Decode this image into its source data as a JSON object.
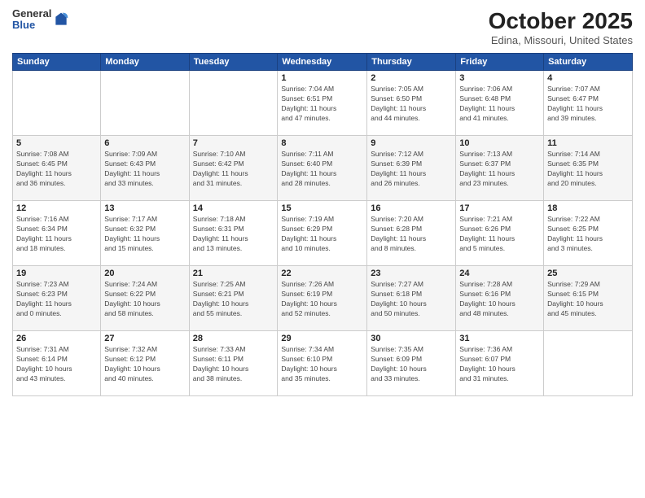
{
  "header": {
    "logo": {
      "general": "General",
      "blue": "Blue"
    },
    "title": "October 2025",
    "location": "Edina, Missouri, United States"
  },
  "days_of_week": [
    "Sunday",
    "Monday",
    "Tuesday",
    "Wednesday",
    "Thursday",
    "Friday",
    "Saturday"
  ],
  "weeks": [
    [
      {
        "day": "",
        "info": ""
      },
      {
        "day": "",
        "info": ""
      },
      {
        "day": "",
        "info": ""
      },
      {
        "day": "1",
        "info": "Sunrise: 7:04 AM\nSunset: 6:51 PM\nDaylight: 11 hours\nand 47 minutes."
      },
      {
        "day": "2",
        "info": "Sunrise: 7:05 AM\nSunset: 6:50 PM\nDaylight: 11 hours\nand 44 minutes."
      },
      {
        "day": "3",
        "info": "Sunrise: 7:06 AM\nSunset: 6:48 PM\nDaylight: 11 hours\nand 41 minutes."
      },
      {
        "day": "4",
        "info": "Sunrise: 7:07 AM\nSunset: 6:47 PM\nDaylight: 11 hours\nand 39 minutes."
      }
    ],
    [
      {
        "day": "5",
        "info": "Sunrise: 7:08 AM\nSunset: 6:45 PM\nDaylight: 11 hours\nand 36 minutes."
      },
      {
        "day": "6",
        "info": "Sunrise: 7:09 AM\nSunset: 6:43 PM\nDaylight: 11 hours\nand 33 minutes."
      },
      {
        "day": "7",
        "info": "Sunrise: 7:10 AM\nSunset: 6:42 PM\nDaylight: 11 hours\nand 31 minutes."
      },
      {
        "day": "8",
        "info": "Sunrise: 7:11 AM\nSunset: 6:40 PM\nDaylight: 11 hours\nand 28 minutes."
      },
      {
        "day": "9",
        "info": "Sunrise: 7:12 AM\nSunset: 6:39 PM\nDaylight: 11 hours\nand 26 minutes."
      },
      {
        "day": "10",
        "info": "Sunrise: 7:13 AM\nSunset: 6:37 PM\nDaylight: 11 hours\nand 23 minutes."
      },
      {
        "day": "11",
        "info": "Sunrise: 7:14 AM\nSunset: 6:35 PM\nDaylight: 11 hours\nand 20 minutes."
      }
    ],
    [
      {
        "day": "12",
        "info": "Sunrise: 7:16 AM\nSunset: 6:34 PM\nDaylight: 11 hours\nand 18 minutes."
      },
      {
        "day": "13",
        "info": "Sunrise: 7:17 AM\nSunset: 6:32 PM\nDaylight: 11 hours\nand 15 minutes."
      },
      {
        "day": "14",
        "info": "Sunrise: 7:18 AM\nSunset: 6:31 PM\nDaylight: 11 hours\nand 13 minutes."
      },
      {
        "day": "15",
        "info": "Sunrise: 7:19 AM\nSunset: 6:29 PM\nDaylight: 11 hours\nand 10 minutes."
      },
      {
        "day": "16",
        "info": "Sunrise: 7:20 AM\nSunset: 6:28 PM\nDaylight: 11 hours\nand 8 minutes."
      },
      {
        "day": "17",
        "info": "Sunrise: 7:21 AM\nSunset: 6:26 PM\nDaylight: 11 hours\nand 5 minutes."
      },
      {
        "day": "18",
        "info": "Sunrise: 7:22 AM\nSunset: 6:25 PM\nDaylight: 11 hours\nand 3 minutes."
      }
    ],
    [
      {
        "day": "19",
        "info": "Sunrise: 7:23 AM\nSunset: 6:23 PM\nDaylight: 11 hours\nand 0 minutes."
      },
      {
        "day": "20",
        "info": "Sunrise: 7:24 AM\nSunset: 6:22 PM\nDaylight: 10 hours\nand 58 minutes."
      },
      {
        "day": "21",
        "info": "Sunrise: 7:25 AM\nSunset: 6:21 PM\nDaylight: 10 hours\nand 55 minutes."
      },
      {
        "day": "22",
        "info": "Sunrise: 7:26 AM\nSunset: 6:19 PM\nDaylight: 10 hours\nand 52 minutes."
      },
      {
        "day": "23",
        "info": "Sunrise: 7:27 AM\nSunset: 6:18 PM\nDaylight: 10 hours\nand 50 minutes."
      },
      {
        "day": "24",
        "info": "Sunrise: 7:28 AM\nSunset: 6:16 PM\nDaylight: 10 hours\nand 48 minutes."
      },
      {
        "day": "25",
        "info": "Sunrise: 7:29 AM\nSunset: 6:15 PM\nDaylight: 10 hours\nand 45 minutes."
      }
    ],
    [
      {
        "day": "26",
        "info": "Sunrise: 7:31 AM\nSunset: 6:14 PM\nDaylight: 10 hours\nand 43 minutes."
      },
      {
        "day": "27",
        "info": "Sunrise: 7:32 AM\nSunset: 6:12 PM\nDaylight: 10 hours\nand 40 minutes."
      },
      {
        "day": "28",
        "info": "Sunrise: 7:33 AM\nSunset: 6:11 PM\nDaylight: 10 hours\nand 38 minutes."
      },
      {
        "day": "29",
        "info": "Sunrise: 7:34 AM\nSunset: 6:10 PM\nDaylight: 10 hours\nand 35 minutes."
      },
      {
        "day": "30",
        "info": "Sunrise: 7:35 AM\nSunset: 6:09 PM\nDaylight: 10 hours\nand 33 minutes."
      },
      {
        "day": "31",
        "info": "Sunrise: 7:36 AM\nSunset: 6:07 PM\nDaylight: 10 hours\nand 31 minutes."
      },
      {
        "day": "",
        "info": ""
      }
    ]
  ]
}
